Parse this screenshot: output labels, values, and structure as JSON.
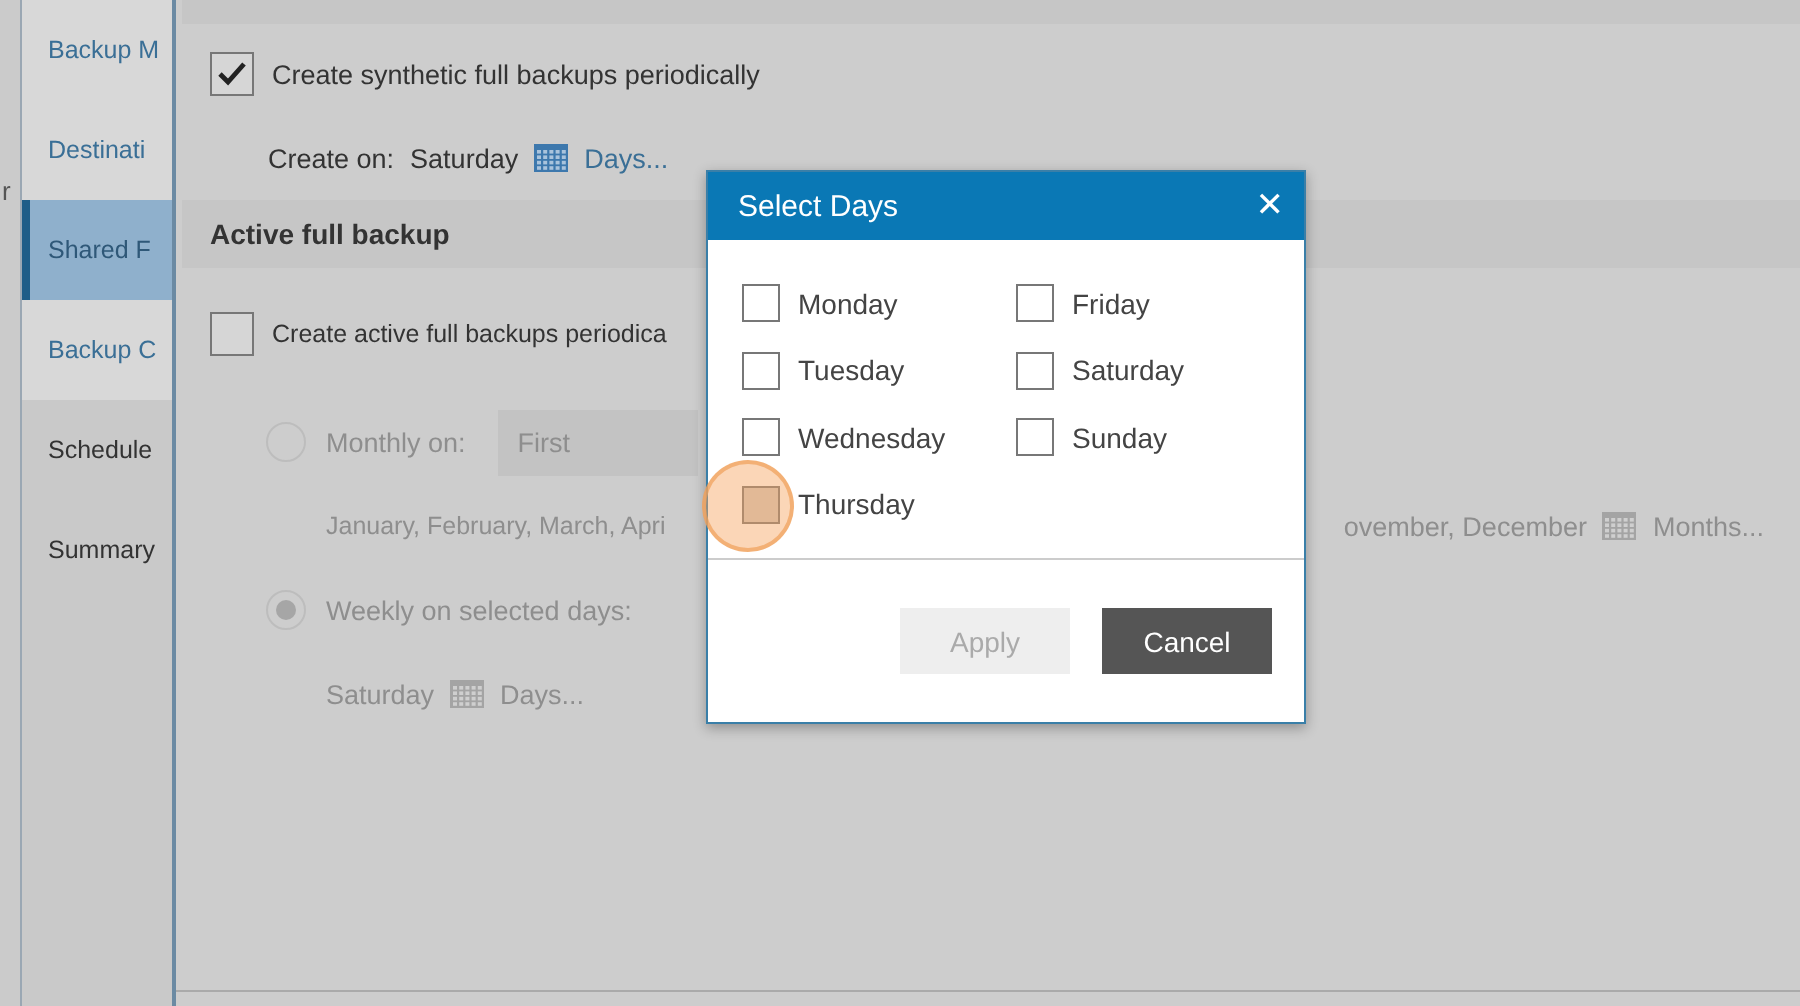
{
  "left_edge_text": "r",
  "sidebar": {
    "items": [
      {
        "label": "Backup M",
        "selected": false,
        "completed": true
      },
      {
        "label": "Destinati",
        "selected": false,
        "completed": true
      },
      {
        "label": "Shared F",
        "selected": true,
        "completed": true
      },
      {
        "label": "Backup C",
        "selected": false,
        "completed": true
      },
      {
        "label": "Schedule",
        "selected": false,
        "completed": false
      },
      {
        "label": "Summary",
        "selected": false,
        "completed": false
      }
    ]
  },
  "synthetic": {
    "checkbox": {
      "label": "Create synthetic full backups periodically",
      "checked": true
    },
    "create_on_label": "Create on:",
    "create_on_value": "Saturday",
    "days_link": "Days..."
  },
  "active": {
    "header": "Active full backup",
    "checkbox": {
      "label": "Create active full backups periodica",
      "checked": false
    },
    "options": [
      {
        "kind": "monthly",
        "label": "Monthly on:",
        "selected": false,
        "dropdown": "First",
        "months_left": "January, February, March, Apri",
        "months_right": "ovember, December",
        "months_link": "Months..."
      },
      {
        "kind": "weekly",
        "label": "Weekly on selected days:",
        "selected": true,
        "days_value": "Saturday",
        "days_link": "Days..."
      }
    ]
  },
  "dialog": {
    "title": "Select Days",
    "close": "✕",
    "days": [
      {
        "label": "Monday",
        "checked": false,
        "hovered": false
      },
      {
        "label": "Tuesday",
        "checked": false,
        "hovered": false
      },
      {
        "label": "Wednesday",
        "checked": false,
        "hovered": false
      },
      {
        "label": "Thursday",
        "checked": false,
        "hovered": true
      },
      {
        "label": "Friday",
        "checked": false,
        "hovered": false
      },
      {
        "label": "Saturday",
        "checked": false,
        "hovered": false
      },
      {
        "label": "Sunday",
        "checked": false,
        "hovered": false
      }
    ],
    "buttons": [
      {
        "label": "Apply",
        "disabled": true
      },
      {
        "label": "Cancel",
        "disabled": false
      }
    ]
  }
}
